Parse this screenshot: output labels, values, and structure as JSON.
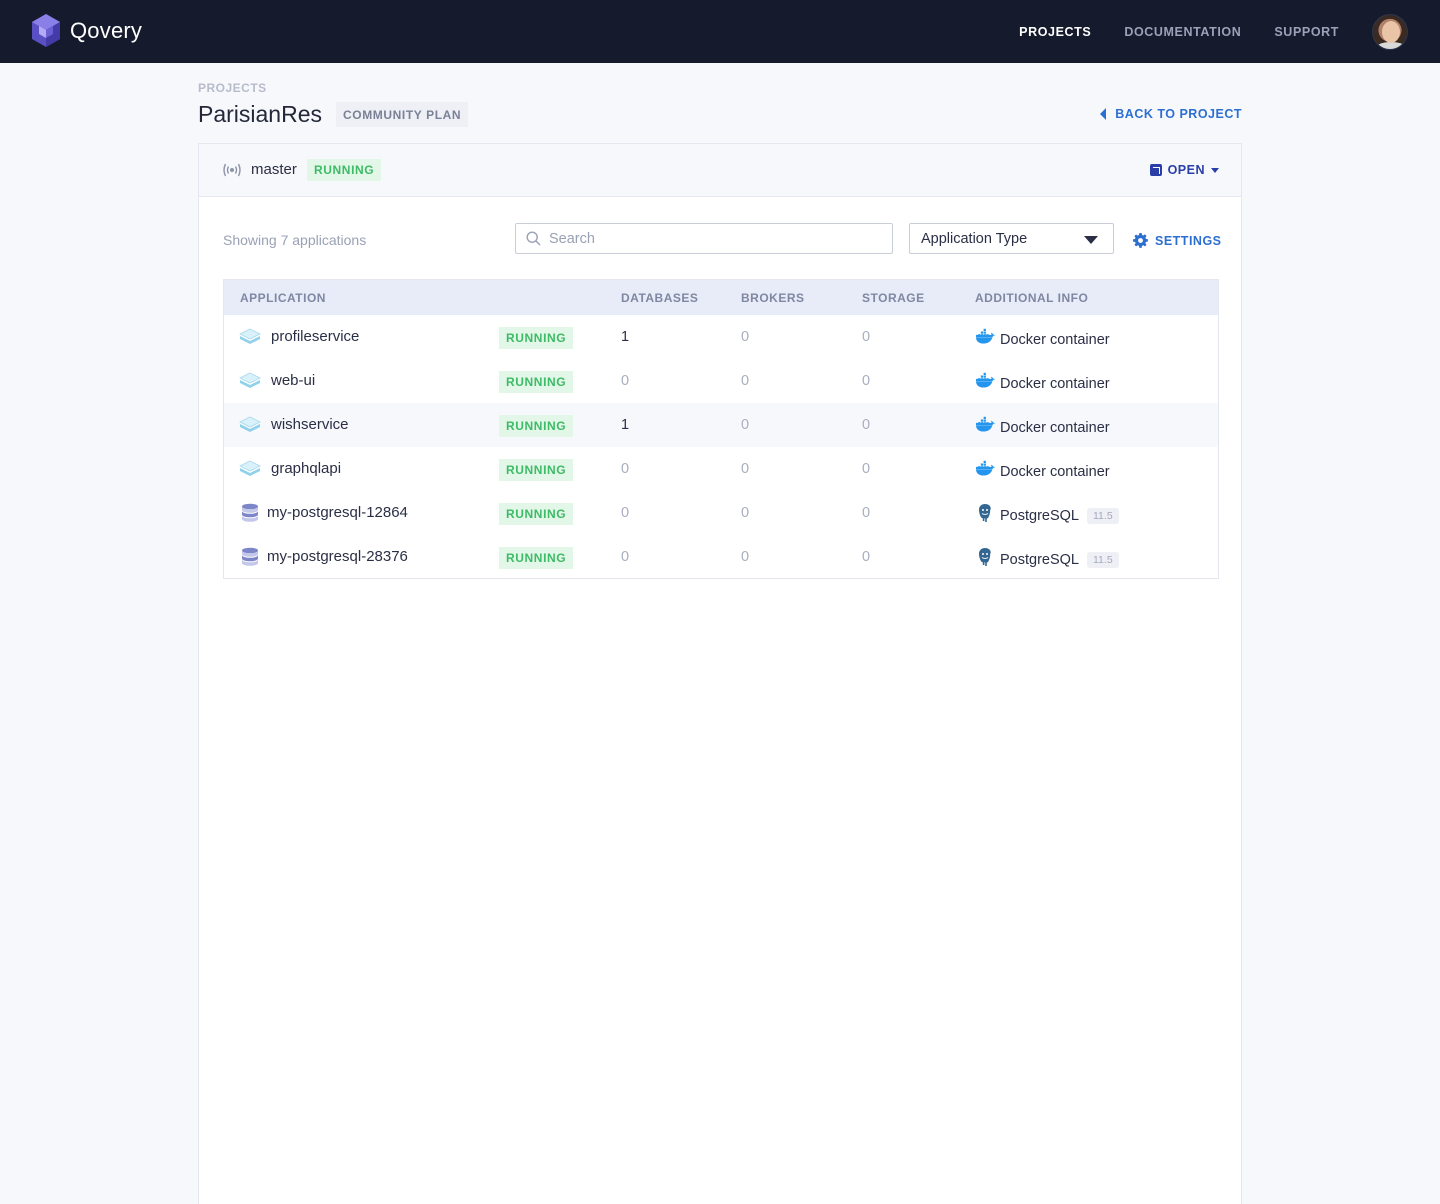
{
  "nav": {
    "logo_text": "Qovery",
    "links": [
      "PROJECTS",
      "DOCUMENTATION",
      "SUPPORT"
    ],
    "active_index": 0
  },
  "header": {
    "breadcrumb": "PROJECTS",
    "title": "ParisianRes",
    "plan_badge": "COMMUNITY PLAN",
    "back_link": "BACK TO PROJECT"
  },
  "environment": {
    "name": "master",
    "status": "RUNNING",
    "open_label": "OPEN"
  },
  "toolbar": {
    "count_text": "Showing 7 applications",
    "search_placeholder": "Search",
    "type_select_label": "Application Type",
    "settings_label": "SETTINGS"
  },
  "table": {
    "columns": [
      "APPLICATION",
      "DATABASES",
      "BROKERS",
      "STORAGE",
      "ADDITIONAL INFO"
    ],
    "rows": [
      {
        "name": "profileservice",
        "kind": "app",
        "status": "RUNNING",
        "databases": "1",
        "brokers": "0",
        "storage": "0",
        "info": "Docker container",
        "info_icon": "docker-icon",
        "version": ""
      },
      {
        "name": "web-ui",
        "kind": "app",
        "status": "RUNNING",
        "databases": "0",
        "brokers": "0",
        "storage": "0",
        "info": "Docker container",
        "info_icon": "docker-icon",
        "version": ""
      },
      {
        "name": "wishservice",
        "kind": "app",
        "status": "RUNNING",
        "databases": "1",
        "brokers": "0",
        "storage": "0",
        "info": "Docker container",
        "info_icon": "docker-icon",
        "version": ""
      },
      {
        "name": "graphqlapi",
        "kind": "app",
        "status": "RUNNING",
        "databases": "0",
        "brokers": "0",
        "storage": "0",
        "info": "Docker container",
        "info_icon": "docker-icon",
        "version": ""
      },
      {
        "name": "my-postgresql-12864",
        "kind": "database",
        "status": "RUNNING",
        "databases": "0",
        "brokers": "0",
        "storage": "0",
        "info": "PostgreSQL",
        "info_icon": "postgresql-icon",
        "version": "11.5"
      },
      {
        "name": "my-postgresql-28376",
        "kind": "database",
        "status": "RUNNING",
        "databases": "0",
        "brokers": "0",
        "storage": "0",
        "info": "PostgreSQL",
        "info_icon": "postgresql-icon",
        "version": "11.5"
      }
    ]
  },
  "colors": {
    "nav_bg": "#151b2d",
    "accent_blue": "#2c6fd1",
    "running_green": "#3dbb66",
    "running_bg": "#e3f7e8"
  }
}
